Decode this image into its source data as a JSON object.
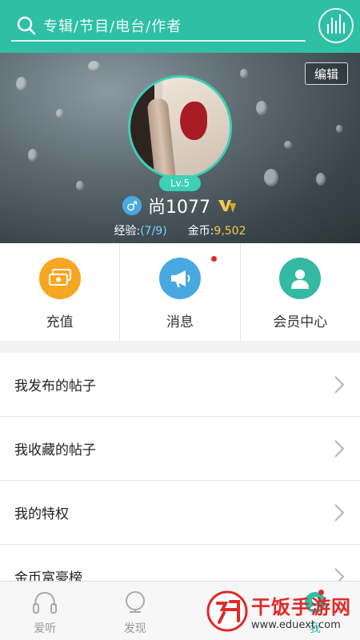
{
  "search": {
    "placeholder": "专辑/节目/电台/作者"
  },
  "profile": {
    "edit_label": "编辑",
    "level": "Lv.5",
    "username": "尚1077",
    "exp_label": "经验:",
    "exp_value": "(7/9)",
    "coins_label": "金币:",
    "coins_value": "9,502"
  },
  "actions": [
    {
      "label": "充值",
      "icon": "recharge-icon",
      "color": "#f6a623"
    },
    {
      "label": "消息",
      "icon": "megaphone-icon",
      "color": "#47a9e0"
    },
    {
      "label": "会员中心",
      "icon": "member-icon",
      "color": "#34b9a3"
    }
  ],
  "list": [
    {
      "label": "我发布的帖子"
    },
    {
      "label": "我收藏的帖子"
    },
    {
      "label": "我的特权"
    },
    {
      "label": "金币富豪榜"
    }
  ],
  "nav": [
    {
      "label": "爱听",
      "icon": "headphones-icon"
    },
    {
      "label": "发现",
      "icon": "globe-icon"
    },
    {
      "label": "",
      "icon": "tv-icon"
    },
    {
      "label": "我",
      "icon": "me-icon"
    }
  ],
  "watermark": {
    "title": "干饭手游网",
    "url": "www.eduext.com"
  },
  "colors": {
    "accent": "#2ebfa5",
    "badge": "#e0292a"
  }
}
